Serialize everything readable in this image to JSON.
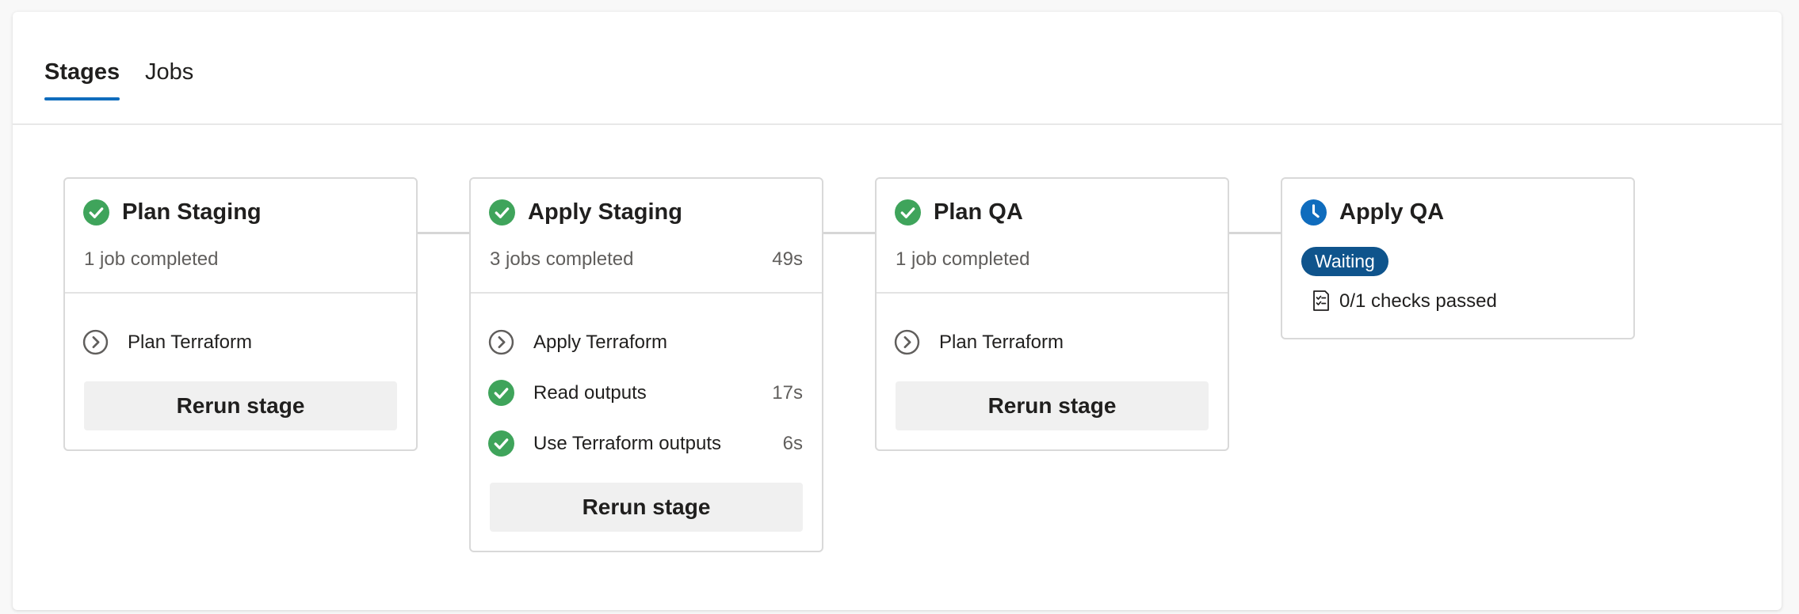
{
  "tabs": [
    {
      "label": "Stages",
      "selected": true
    },
    {
      "label": "Jobs",
      "selected": false
    }
  ],
  "colors": {
    "success": "#3fa45b",
    "waiting": "#0f6cbd",
    "badge": "#0f548c",
    "tab_underline": "#0f6cbd"
  },
  "stages": [
    {
      "title": "Plan Staging",
      "status": "success",
      "icon": "check-circle-icon",
      "summary": "1 job completed",
      "duration": "",
      "jobs": [
        {
          "label": "Plan Terraform",
          "icon": "chevron-right-circle-icon",
          "duration": ""
        }
      ],
      "rerun_label": "Rerun stage"
    },
    {
      "title": "Apply Staging",
      "status": "success",
      "icon": "check-circle-icon",
      "summary": "3 jobs completed",
      "duration": "49s",
      "jobs": [
        {
          "label": "Apply Terraform",
          "icon": "chevron-right-circle-icon",
          "duration": ""
        },
        {
          "label": "Read outputs",
          "icon": "check-circle-icon",
          "duration": "17s"
        },
        {
          "label": "Use Terraform outputs",
          "icon": "check-circle-icon",
          "duration": "6s"
        }
      ],
      "rerun_label": "Rerun stage"
    },
    {
      "title": "Plan QA",
      "status": "success",
      "icon": "check-circle-icon",
      "summary": "1 job completed",
      "duration": "",
      "jobs": [
        {
          "label": "Plan Terraform",
          "icon": "chevron-right-circle-icon",
          "duration": ""
        }
      ],
      "rerun_label": "Rerun stage"
    },
    {
      "title": "Apply QA",
      "status": "waiting",
      "icon": "clock-icon",
      "badge": "Waiting",
      "checks": {
        "label": "0/1 checks passed",
        "icon": "checklist-icon"
      }
    }
  ]
}
